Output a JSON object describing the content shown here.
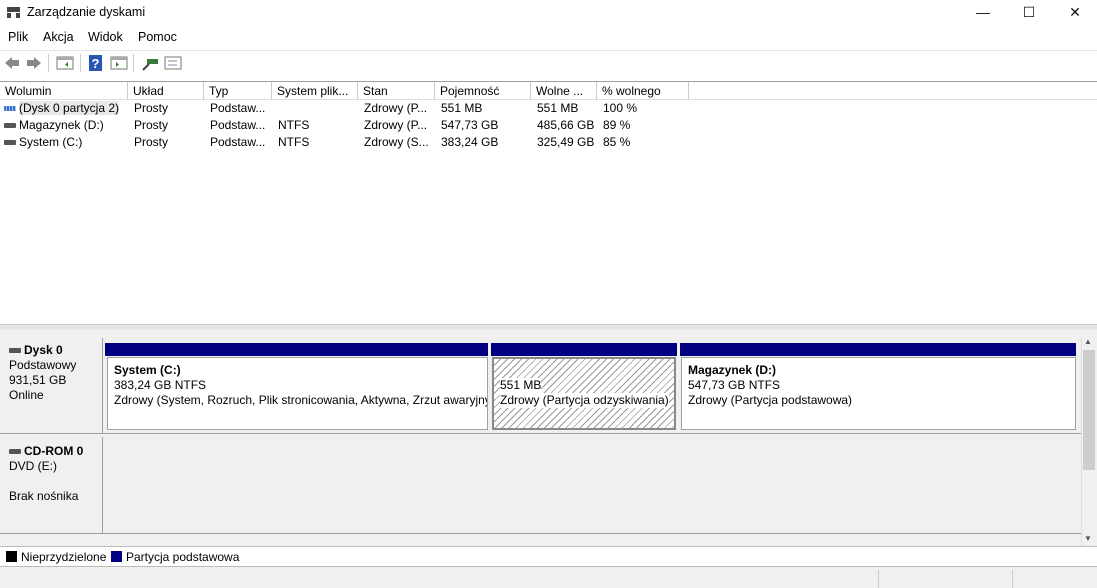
{
  "window": {
    "title": "Zarządzanie dyskami",
    "minimize": "—",
    "maximize": "☐",
    "close": "✕"
  },
  "menu": [
    "Plik",
    "Akcja",
    "Widok",
    "Pomoc"
  ],
  "toolbar": [
    "back-icon",
    "forward-icon",
    "console-tree-icon",
    "help-icon",
    "action-pane-icon",
    "rescan-icon",
    "properties-icon"
  ],
  "columns": [
    "Wolumin",
    "Układ",
    "Typ",
    "System plik...",
    "Stan",
    "Pojemność",
    "Wolne ...",
    "% wolnego"
  ],
  "volumes": [
    [
      "(Dysk 0 partycja 2)",
      "Prosty",
      "Podstaw...",
      "",
      "Zdrowy (P...",
      "551 MB",
      "551 MB",
      "100 %"
    ],
    [
      "Magazynek (D:)",
      "Prosty",
      "Podstaw...",
      "NTFS",
      "Zdrowy (P...",
      "547,73 GB",
      "485,66 GB",
      "89 %"
    ],
    [
      "System (C:)",
      "Prosty",
      "Podstaw...",
      "NTFS",
      "Zdrowy (S...",
      "383,24 GB",
      "325,49 GB",
      "85 %"
    ]
  ],
  "disks": [
    {
      "name": "Dysk 0",
      "type": "Podstawowy",
      "size": "931,51 GB",
      "status": "Online",
      "partitions": [
        {
          "name": "System  (C:)",
          "size": "383,24 GB NTFS",
          "status": "Zdrowy (System, Rozruch, Plik stronicowania, Aktywna, Zrzut awaryjny"
        },
        {
          "name": "",
          "size": "551 MB",
          "status": "Zdrowy (Partycja odzyskiwania)"
        },
        {
          "name": "Magazynek  (D:)",
          "size": "547,73 GB NTFS",
          "status": "Zdrowy (Partycja podstawowa)"
        }
      ]
    },
    {
      "name": "CD-ROM 0",
      "type": "DVD (E:)",
      "status": "Brak nośnika"
    }
  ],
  "legend": [
    {
      "label": "Nieprzydzielone",
      "color": "#000000"
    },
    {
      "label": "Partycja podstawowa",
      "color": "#000080"
    }
  ]
}
